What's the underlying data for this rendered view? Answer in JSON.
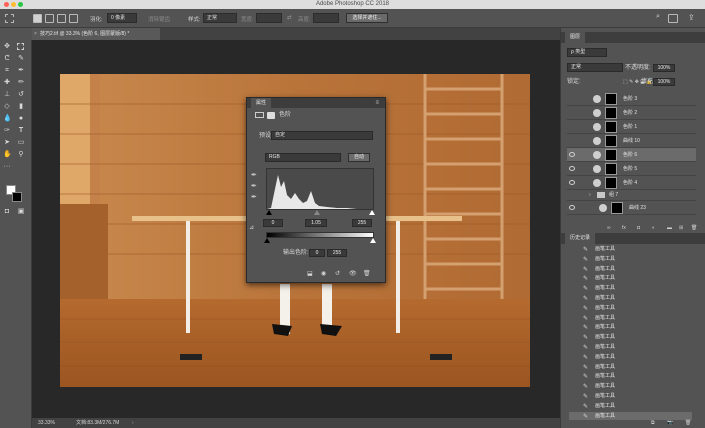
{
  "app": {
    "title": "Adobe Photoshop CC 2018"
  },
  "options_bar": {
    "feather_label": "羽化:",
    "feather_value": "0 像素",
    "antialias_label": "消除锯齿",
    "style_label": "样式:",
    "style_value": "正常",
    "width_label": "宽度:",
    "height_label": "高度:",
    "select_mask_button": "选择并遮住..."
  },
  "document_tab": {
    "label": "技巧2.tif @ 33.3% (色阶 6, 图层蒙版/8) *"
  },
  "status_bar": {
    "zoom": "33.33%",
    "doc_size": "文档:83.3M/276.7M"
  },
  "properties": {
    "panel_title": "属性",
    "adjustment_name": "色阶",
    "preset_label": "预设:",
    "preset_value": "自定",
    "channel_value": "RGB",
    "auto_button": "自动",
    "input_black": "0",
    "input_gamma": "1.05",
    "input_white": "255",
    "output_label": "输出色阶:",
    "output_black": "0",
    "output_white": "255"
  },
  "layers_panel": {
    "tab": "图层",
    "filter_kind": "ρ 类型",
    "blend_mode": "正常",
    "opacity_label": "不透明度:",
    "opacity_value": "100%",
    "lock_label": "锁定:",
    "fill_label": "填充:",
    "fill_value": "100%",
    "layers": [
      {
        "name": "色阶 3",
        "visible": false,
        "selected": false
      },
      {
        "name": "色阶 2",
        "visible": false,
        "selected": false
      },
      {
        "name": "色阶 1",
        "visible": false,
        "selected": false
      },
      {
        "name": "曲线 10",
        "visible": false,
        "selected": false
      },
      {
        "name": "色阶 6",
        "visible": true,
        "selected": true
      },
      {
        "name": "色阶 5",
        "visible": true,
        "selected": false
      },
      {
        "name": "色阶 4",
        "visible": true,
        "selected": false
      }
    ],
    "group_name": "组 7",
    "group_layer": "曲线 23"
  },
  "history_panel": {
    "tab": "历史记录",
    "items": [
      {
        "name": "画笔工具",
        "icon": "brush-icon"
      },
      {
        "name": "画笔工具",
        "icon": "brush-icon"
      },
      {
        "name": "画笔工具",
        "icon": "brush-icon"
      },
      {
        "name": "画笔工具",
        "icon": "brush-icon"
      },
      {
        "name": "画笔工具",
        "icon": "brush-icon"
      },
      {
        "name": "画笔工具",
        "icon": "brush-icon"
      },
      {
        "name": "画笔工具",
        "icon": "brush-icon"
      },
      {
        "name": "画笔工具",
        "icon": "brush-icon"
      },
      {
        "name": "画笔工具",
        "icon": "brush-icon"
      },
      {
        "name": "画笔工具",
        "icon": "brush-icon"
      },
      {
        "name": "画笔工具",
        "icon": "brush-icon"
      },
      {
        "name": "画笔工具",
        "icon": "brush-icon"
      },
      {
        "name": "画笔工具",
        "icon": "brush-icon"
      },
      {
        "name": "画笔工具",
        "icon": "brush-icon"
      },
      {
        "name": "画笔工具",
        "icon": "brush-icon"
      },
      {
        "name": "画笔工具",
        "icon": "brush-icon"
      },
      {
        "name": "画笔工具",
        "icon": "brush-icon"
      },
      {
        "name": "画笔工具",
        "icon": "brush-icon"
      },
      {
        "name": "画笔工具",
        "icon": "brush-icon"
      },
      {
        "name": "画笔工具",
        "icon": "brush-icon"
      },
      {
        "name": "画笔工具",
        "icon": "brush-icon"
      },
      {
        "name": "画笔工具",
        "icon": "brush-icon"
      },
      {
        "name": "画笔工具",
        "icon": "brush-icon"
      },
      {
        "name": "画笔工具",
        "icon": "brush-icon"
      },
      {
        "name": "画笔工具",
        "icon": "brush-icon"
      },
      {
        "name": "画笔工具",
        "icon": "brush-icon"
      },
      {
        "name": "画笔工具",
        "icon": "brush-icon"
      },
      {
        "name": "画笔工具",
        "icon": "brush-icon"
      },
      {
        "name": "画笔工具",
        "icon": "brush-icon"
      },
      {
        "name": "画笔工具",
        "icon": "brush-icon"
      },
      {
        "name": "画笔工具",
        "icon": "brush-icon"
      },
      {
        "name": "画笔工具",
        "icon": "brush-icon"
      },
      {
        "name": "画笔工具",
        "icon": "brush-icon"
      },
      {
        "name": "画笔工具",
        "icon": "brush-icon"
      },
      {
        "name": "画笔工具",
        "icon": "brush-icon"
      },
      {
        "name": "画笔工具",
        "icon": "brush-icon"
      },
      {
        "name": "画笔工具",
        "icon": "brush-icon"
      },
      {
        "name": "画笔工具",
        "icon": "brush-icon"
      },
      {
        "name": "画笔工具",
        "icon": "brush-icon"
      },
      {
        "name": "画笔工具",
        "icon": "brush-icon"
      },
      {
        "name": "画笔工具",
        "icon": "brush-icon"
      },
      {
        "name": "画笔工具",
        "icon": "brush-icon"
      },
      {
        "name": "画笔工具",
        "icon": "brush-icon"
      },
      {
        "name": "画笔工具",
        "icon": "brush-icon"
      },
      {
        "name": "画笔工具",
        "icon": "brush-icon"
      },
      {
        "name": "画笔工具",
        "icon": "brush-icon"
      },
      {
        "name": "画笔工具",
        "icon": "brush-icon"
      },
      {
        "name": "画笔工具",
        "icon": "brush-icon"
      },
      {
        "name": "画笔工具",
        "icon": "brush-icon"
      },
      {
        "name": "画笔工具",
        "icon": "brush-icon"
      },
      {
        "name": "画笔工具",
        "icon": "brush-icon"
      },
      {
        "name": "画笔工具",
        "icon": "brush-icon"
      },
      {
        "name": "画笔工具",
        "icon": "brush-icon"
      },
      {
        "name": "画笔工具",
        "icon": "brush-icon"
      },
      {
        "name": "画笔工具",
        "icon": "brush-icon"
      }
    ]
  },
  "colors": {
    "accent": "#4a90d9",
    "panel": "#535353",
    "canvas": "#282828"
  }
}
